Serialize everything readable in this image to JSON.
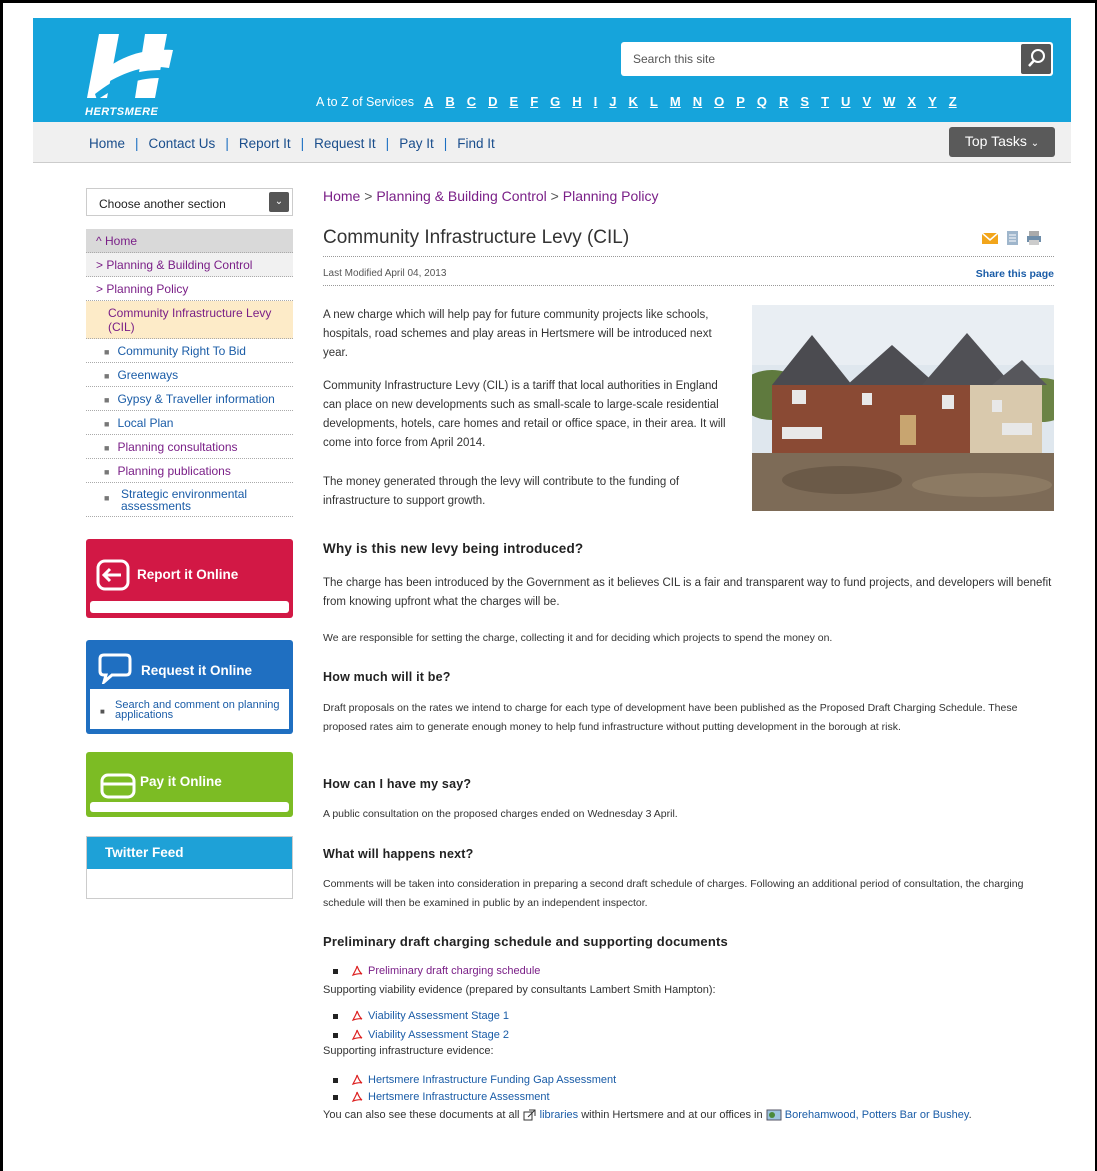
{
  "header": {
    "logo_text": "HERTSMERE",
    "search_placeholder": "Search this site",
    "az_label": "A to Z of Services",
    "letters": [
      "A",
      "B",
      "C",
      "D",
      "E",
      "F",
      "G",
      "H",
      "I",
      "J",
      "K",
      "L",
      "M",
      "N",
      "O",
      "P",
      "Q",
      "R",
      "S",
      "T",
      "U",
      "V",
      "W",
      "X",
      "Y",
      "Z"
    ]
  },
  "nav": {
    "items": [
      "Home",
      "Contact Us",
      "Report It",
      "Request It",
      "Pay It",
      "Find It"
    ],
    "top_tasks": "Top Tasks"
  },
  "sidebar": {
    "choose": "Choose another section",
    "home": "Home",
    "planning_building": "Planning & Building Control",
    "planning_policy": "Planning Policy",
    "current": "Community Infrastructure Levy (CIL)",
    "subs": [
      "Community Right To Bid",
      "Greenways",
      "Gypsy & Traveller information",
      "Local Plan",
      "Planning consultations",
      "Planning publications",
      "Strategic environmental assessments"
    ],
    "report_title": "Report it Online",
    "request_title": "Request it Online",
    "request_link": "Search and comment on planning applications",
    "pay_title": "Pay it Online",
    "twitter_title": "Twitter Feed"
  },
  "main": {
    "crumb_home": "Home",
    "crumb_pbc": "Planning & Building Control",
    "crumb_pp": "Planning Policy",
    "title": "Community Infrastructure Levy (CIL)",
    "modified": "Last Modified April 04, 2013",
    "share": "Share this page",
    "p1": "A new charge which will help pay for future community projects like schools, hospitals, road schemes and play areas in Hertsmere will be introduced next year.",
    "p2": "Community Infrastructure Levy (CIL) is a tariff that local authorities in England can place on new developments such as small-scale to large-scale residential developments, hotels, care homes and retail or office space, in their area.  It will come into force from April 2014.",
    "p3": "The money generated through the levy will contribute to the funding of infrastructure to support growth.",
    "h_why": "Why is this new levy being introduced?",
    "p4": "The charge has been introduced by the Government as it believes CIL is a fair and transparent way to fund projects, and developers will benefit from knowing upfront what the charges will be.",
    "p5": "We are responsible for setting the charge, collecting it and for deciding which projects to spend the money on.",
    "h_much": "How much will it be?",
    "p6": "Draft proposals on the rates we intend to charge for each type of development have been published as the Proposed Draft Charging Schedule. These proposed rates aim to generate enough money to help fund infrastructure without putting development in the borough at risk.",
    "h_say": "How can I have my say?",
    "p7": "A public consultation on the proposed charges ended on Wednesday 3 April.",
    "h_next": "What will happens next?",
    "p8": "Comments will be taken into consideration in preparing a second draft schedule of charges. Following an additional period of consultation, the charging schedule will then be examined in public by an independent inspector.",
    "h_docs": "Preliminary draft charging schedule and supporting documents",
    "doc1": "Preliminary draft charging schedule",
    "support_viab": "Supporting viability evidence (prepared by consultants Lambert Smith Hampton):",
    "doc2": "Viability Assessment Stage 1",
    "doc3": "Viability Assessment Stage 2",
    "support_infra": "Supporting infrastructure evidence:",
    "doc4": "Hertsmere Infrastructure Funding Gap Assessment",
    "doc5": "Hertsmere Infrastructure Assessment",
    "also_pre": "You can also see these documents at all",
    "also_lib": "libraries",
    "also_mid": "within Hertsmere and at our offices in",
    "also_offices": "Borehamwood, Potters Bar or Bushey",
    "also_end": "."
  },
  "colors": {
    "header_blue": "#16a4db",
    "report_red": "#d21845",
    "request_blue": "#1f6fc1",
    "pay_green": "#7cbc24",
    "twitter_blue": "#1ea1d7",
    "link_purple": "#7a1f87"
  }
}
